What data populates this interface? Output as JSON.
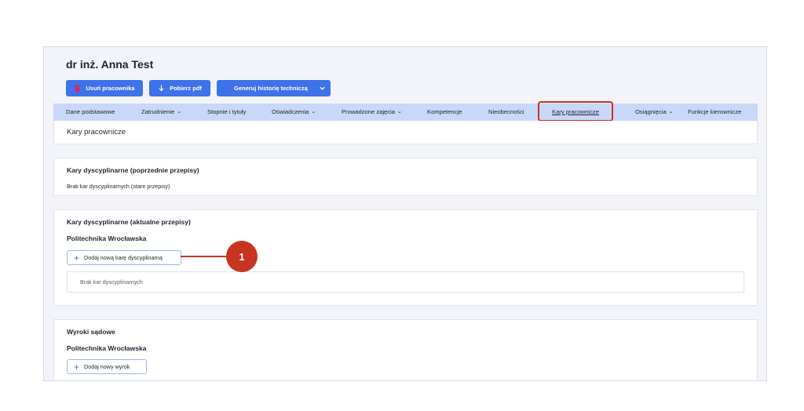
{
  "header": {
    "name": "dr inż. Anna Test"
  },
  "actions": {
    "delete_label": "Usuń pracownika",
    "pdf_label": "Pobierz pdf",
    "history_label": "Generuj historię techniczą"
  },
  "tabs": [
    {
      "label": "Dane podstawowe",
      "dropdown": false
    },
    {
      "label": "Zatrudnienie",
      "dropdown": true
    },
    {
      "label": "Stopnie i tytuły",
      "dropdown": false
    },
    {
      "label": "Oświadczenia",
      "dropdown": true
    },
    {
      "label": "Prowadzone zajęcia",
      "dropdown": true
    },
    {
      "label": "Kompetencje",
      "dropdown": false
    },
    {
      "label": "Nieobecności",
      "dropdown": false
    },
    {
      "label": "Kary pracownicze",
      "dropdown": false,
      "active": true
    },
    {
      "label": "Osiągnięcia",
      "dropdown": true
    },
    {
      "label": "Funkcje kierownicze",
      "dropdown": false
    }
  ],
  "section_title": "Kary pracownicze",
  "old_rules": {
    "title": "Kary dyscyplinarne (poprzednie przepisy)",
    "empty_text": "Brak kar dyscyplinarnych (stare przepisy)"
  },
  "current_rules": {
    "title": "Kary dyscyplinarne (aktualne przepisy)",
    "institution": "Politechnika Wrocławska",
    "add_label": "Dodaj nową karę dyscyplinarną",
    "empty_text": "Brak kar dyscyplinarnych"
  },
  "court": {
    "title": "Wyroki sądowe",
    "institution": "Politechnika Wrocławska",
    "add_label": "Dodaj nowy wyrok"
  },
  "callout": {
    "number": "1"
  },
  "colors": {
    "accent": "#3d72e8",
    "tab_bar": "#c9d7f9",
    "highlight": "#c8341f"
  }
}
